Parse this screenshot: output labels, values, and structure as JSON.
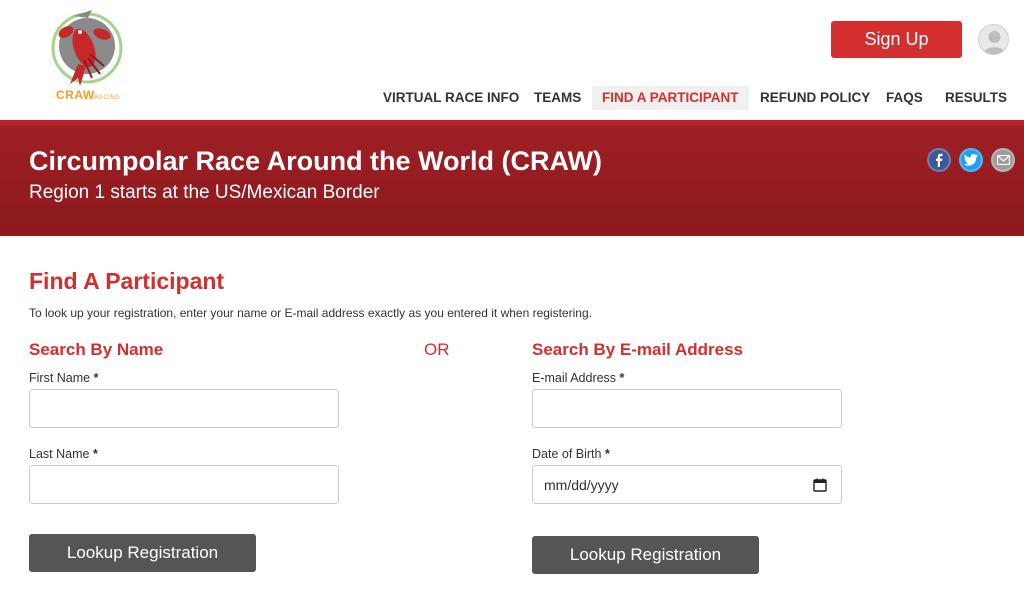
{
  "brand": {
    "logo_text": "CRAW",
    "logo_subtext": "RACING"
  },
  "header": {
    "signup_label": "Sign Up"
  },
  "nav": {
    "items": [
      {
        "label": "VIRTUAL RACE INFO"
      },
      {
        "label": "TEAMS"
      },
      {
        "label": "FIND A PARTICIPANT"
      },
      {
        "label": "REFUND POLICY"
      },
      {
        "label": "FAQS"
      },
      {
        "label": "RESULTS"
      }
    ],
    "active_index": 2
  },
  "banner": {
    "title": "Circumpolar Race Around the World (CRAW)",
    "subtitle": "Region 1 starts at the US/Mexican Border",
    "share_icons": [
      "facebook-icon",
      "twitter-icon",
      "email-icon"
    ]
  },
  "content": {
    "heading": "Find A Participant",
    "instructions": "To look up your registration, enter your name or E-mail address exactly as you entered it when registering.",
    "or_label": "OR",
    "by_name": {
      "heading": "Search By Name",
      "first_name_label": "First Name",
      "first_name_value": "",
      "last_name_label": "Last Name",
      "last_name_value": "",
      "button_label": "Lookup Registration"
    },
    "by_email": {
      "heading": "Search By E-mail Address",
      "email_label": "E-mail Address",
      "email_value": "",
      "dob_label": "Date of Birth",
      "dob_placeholder": "mm/dd/yyyy",
      "button_label": "Lookup Registration"
    },
    "required_marker": "*"
  },
  "colors": {
    "accent": "#d32f2f",
    "banner": "#9e1f23",
    "button_dark": "#555555"
  }
}
